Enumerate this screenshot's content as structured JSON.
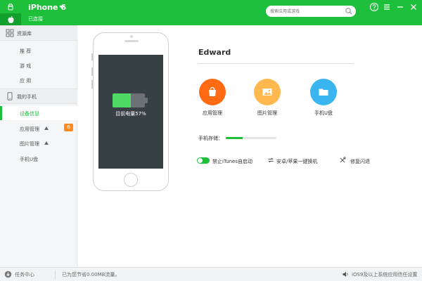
{
  "header": {
    "device_name": "iPhone 6",
    "status": "已连接",
    "search_placeholder": "搜索应用或游戏",
    "icons": [
      "android-icon",
      "apple-icon",
      "search-icon",
      "help-icon",
      "menu-icon",
      "minimize-icon",
      "close-icon"
    ],
    "colors": {
      "brand_green": "#1ebf3b",
      "brand_green_dark": "#12a02c"
    }
  },
  "sidebar": {
    "resources_header": "资源库",
    "resources_items": [
      "推 荐",
      "游 戏",
      "应 用"
    ],
    "phone_header": "我的手机",
    "phone_items": [
      {
        "label": "设备信息",
        "active": true
      },
      {
        "label": "应用管理",
        "badge": "6"
      },
      {
        "label": "图片管理"
      },
      {
        "label": "手机U盘"
      }
    ]
  },
  "device": {
    "battery_label": "目前电量57%",
    "battery_level": 0.57,
    "owner_name": "Edward",
    "tiles": [
      {
        "label": "应用管理",
        "icon": "shopping-bag-icon",
        "color": "#ff6a13"
      },
      {
        "label": "图片管理",
        "icon": "picture-icon",
        "color": "#ffb84d"
      },
      {
        "label": "手机U盘",
        "icon": "folder-icon",
        "color": "#39b5f0"
      }
    ],
    "storage_label": "手机存储：",
    "storage_level": 0.33,
    "options": {
      "itunes_toggle_label": "禁止iTunes自启动",
      "itunes_toggle_on": true,
      "switch_phone_label": "安卓/苹果一键换机",
      "fix_crash_label": "修复闪退"
    }
  },
  "footer": {
    "task_center": "任务中心",
    "saved_traffic": "已为您节省0.00MB流量。",
    "trust_settings": "iOS9及以上系统应用信任设置"
  }
}
